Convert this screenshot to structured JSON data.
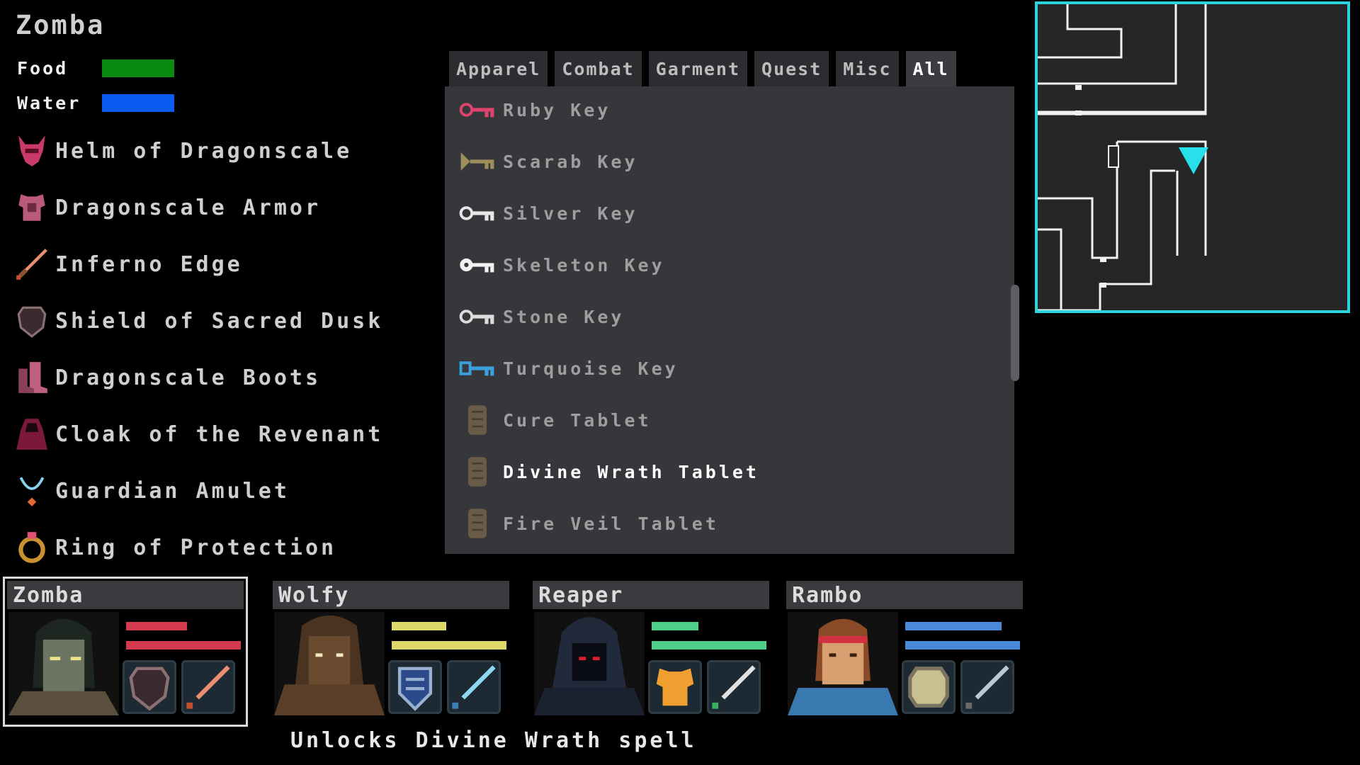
{
  "character": {
    "name": "Zomba"
  },
  "needs": [
    {
      "label": "Food",
      "color": "#0b8a12"
    },
    {
      "label": "Water",
      "color": "#0a5cf0"
    }
  ],
  "equipment": [
    {
      "label": "Helm of Dragonscale",
      "icon": "helm-icon"
    },
    {
      "label": "Dragonscale Armor",
      "icon": "armor-icon"
    },
    {
      "label": "Inferno Edge",
      "icon": "sword-icon"
    },
    {
      "label": "Shield of Sacred Dusk",
      "icon": "shield-icon"
    },
    {
      "label": "Dragonscale Boots",
      "icon": "boots-icon"
    },
    {
      "label": "Cloak of the Revenant",
      "icon": "cloak-icon"
    },
    {
      "label": "Guardian Amulet",
      "icon": "amulet-icon"
    },
    {
      "label": "Ring of Protection",
      "icon": "ring-icon"
    }
  ],
  "tabs": [
    {
      "label": "Apparel",
      "active": false
    },
    {
      "label": "Combat",
      "active": false
    },
    {
      "label": "Garment",
      "active": false
    },
    {
      "label": "Quest",
      "active": false
    },
    {
      "label": "Misc",
      "active": false
    },
    {
      "label": "All",
      "active": true
    }
  ],
  "inventory": [
    {
      "label": "Ruby Key",
      "icon": "key-icon",
      "color": "#e0446e"
    },
    {
      "label": "Scarab Key",
      "icon": "key-icon",
      "color": "#a08e5a"
    },
    {
      "label": "Silver Key",
      "icon": "key-icon",
      "color": "#e8e8e8"
    },
    {
      "label": "Skeleton Key",
      "icon": "key-icon",
      "color": "#f2f2f2"
    },
    {
      "label": "Stone Key",
      "icon": "key-icon",
      "color": "#dcdcdc"
    },
    {
      "label": "Turquoise Key",
      "icon": "key-icon",
      "color": "#3aa0e0"
    },
    {
      "label": "Cure Tablet",
      "icon": "tablet-icon",
      "color": "#6a5a48"
    },
    {
      "label": "Divine Wrath Tablet",
      "icon": "tablet-icon",
      "color": "#6a5a48",
      "selected": true
    },
    {
      "label": "Fire Veil Tablet",
      "icon": "tablet-icon",
      "color": "#6a5a48"
    }
  ],
  "party": [
    {
      "name": "Zomba",
      "selected": true,
      "bar_color": "#d43a4e",
      "hp_fill": 0.52,
      "mp_fill": 1.0,
      "skin": "#6c7562",
      "hair": "#1d2620",
      "eyes": "#f0e28a"
    },
    {
      "name": "Wolfy",
      "selected": false,
      "bar_color": "#dcd86a",
      "hp_fill": 0.48,
      "mp_fill": 1.0,
      "skin": "#6a4b30",
      "hair": "#4a3320",
      "eyes": "#f4e8c0"
    },
    {
      "name": "Reaper",
      "selected": false,
      "bar_color": "#4fce8a",
      "hp_fill": 0.41,
      "mp_fill": 1.0,
      "skin": "#0a0d14",
      "hair": "#202a3a",
      "eyes": "#e02030"
    },
    {
      "name": "Rambo",
      "selected": false,
      "bar_color": "#4a88d8",
      "hp_fill": 0.84,
      "mp_fill": 1.0,
      "skin": "#d8a070",
      "hair": "#8a4a28",
      "eyes": "#3a2010"
    }
  ],
  "tooltip": "Unlocks Divine Wrath spell",
  "minimap": {
    "border_color": "#2ad4dc",
    "marker_color": "#27e0ea"
  }
}
